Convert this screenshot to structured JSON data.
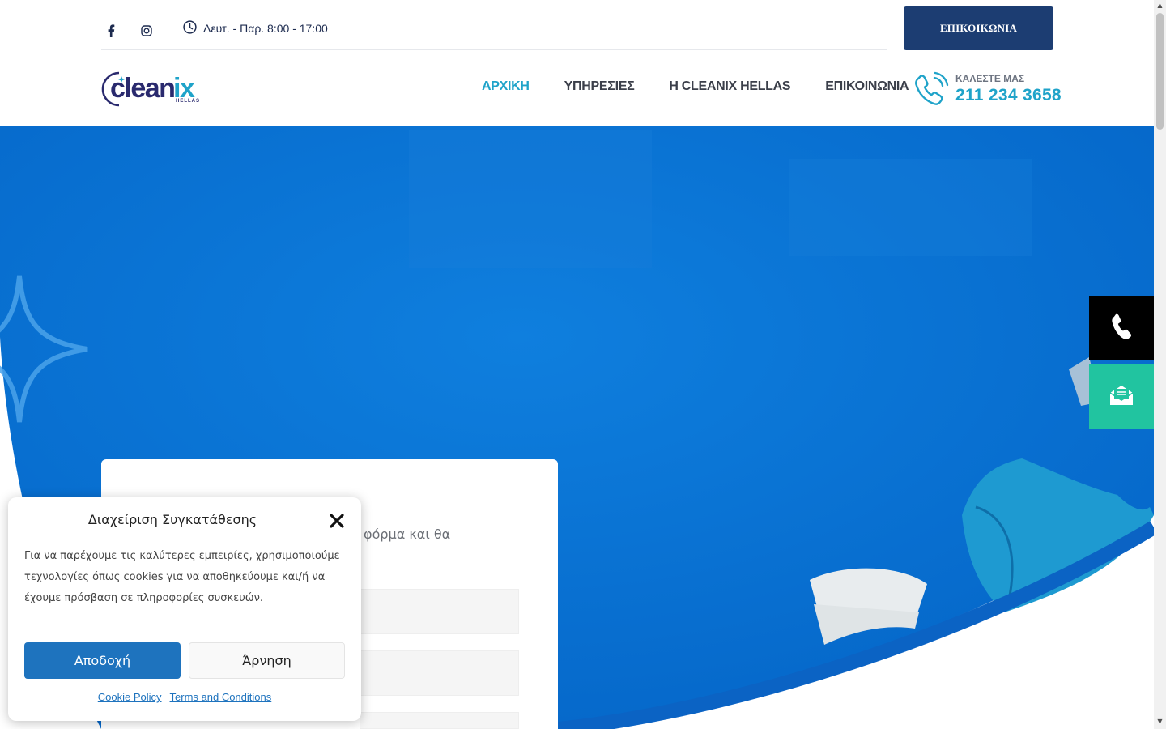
{
  "topbar": {
    "social": [
      {
        "icon": "facebook-icon",
        "glyph": "f"
      },
      {
        "icon": "instagram-icon",
        "glyph": "◎"
      }
    ],
    "hours_icon": "clock-icon",
    "hours": "Δευτ. - Παρ. 8:00 - 17:00",
    "contact_button": "ΕΠΙΚΟΙΚΩΝΙΑ"
  },
  "header": {
    "logo": {
      "main": "cleanix",
      "sub": "HELLAS"
    },
    "nav": [
      {
        "label": "ΑΡΧΙΚΗ",
        "active": true
      },
      {
        "label": "ΥΠΗΡΕΣΙΕΣ",
        "active": false
      },
      {
        "label": "Η CLEANIX HELLAS",
        "active": false
      },
      {
        "label": "ΕΠΙΚΟΙΝΩΝΙΑ",
        "active": false
      }
    ],
    "call_label": "ΚΑΛΕΣΤΕ ΜΑΣ",
    "call_number": "211 234 3658"
  },
  "hero": {
    "form_text_partial": "ν φόρμα και θα"
  },
  "floating": {
    "phone_icon": "phone-icon",
    "mail_icon": "mail-icon"
  },
  "cookie": {
    "title": "Διαχείριση Συγκατάθεσης",
    "close": "✕",
    "text": "Για να παρέχουμε τις καλύτερες εμπειρίες, χρησιμοποιούμε τεχνολογίες όπως cookies για να αποθηκεύουμε και/ή να έχουμε πρόσβαση σε πληροφορίες συσκευών.",
    "accept": "Αποδοχή",
    "deny": "Άρνηση",
    "links": [
      "Cookie Policy",
      "Terms and Conditions"
    ]
  },
  "colors": {
    "hero_blue": "#0a74d6",
    "brand_navy": "#1c3d72",
    "accent_cyan": "#1fa3c9",
    "mail_green": "#21c4a0",
    "cookie_blue": "#1e73be"
  }
}
